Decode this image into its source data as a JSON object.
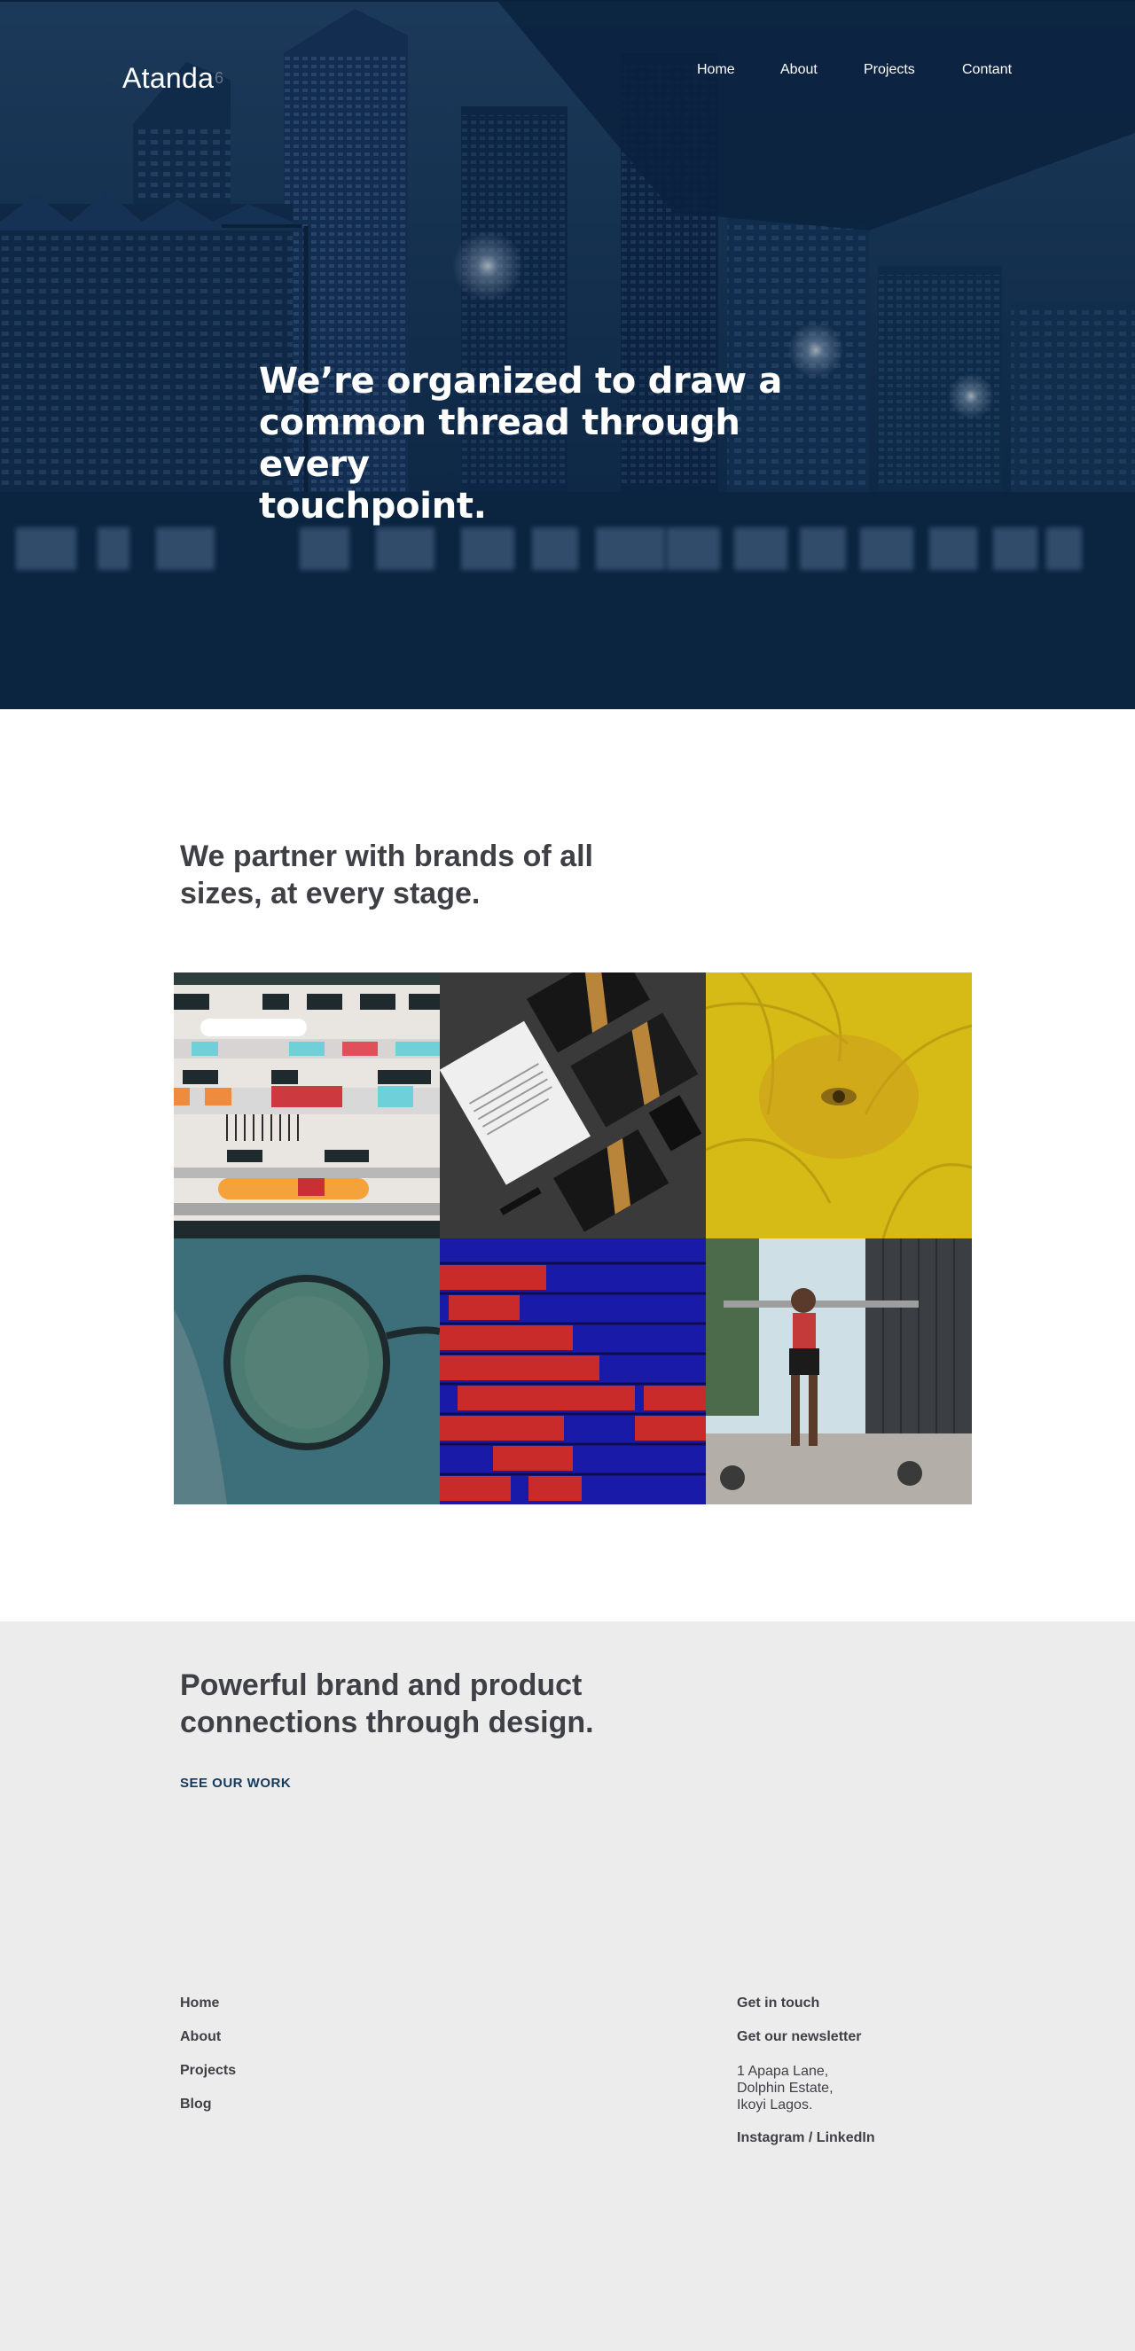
{
  "header": {
    "logo": "Atanda",
    "logo_mark": "6",
    "nav": [
      {
        "label": "Home"
      },
      {
        "label": "About"
      },
      {
        "label": "Projects"
      },
      {
        "label": "Contant"
      }
    ]
  },
  "hero": {
    "title_lines": [
      "We’re organized to draw a",
      "common thread through every",
      "touchpoint."
    ],
    "background": "night-city-street-photo",
    "overlay_color": "#0b2540"
  },
  "intro": {
    "lines": [
      "We partner with brands of all",
      "sizes, at every stage."
    ]
  },
  "gallery": [
    {
      "name": "colorful-apartment-building-image"
    },
    {
      "name": "black-gold-stationery-mockup-image"
    },
    {
      "name": "yellow-fern-eye-image"
    },
    {
      "name": "eyeglasses-in-hand-image"
    },
    {
      "name": "red-blue-brick-wall-image"
    },
    {
      "name": "weightlifter-outdoors-image"
    }
  ],
  "cta_section": {
    "lines": [
      "Powerful brand and product",
      "connections through design."
    ],
    "link": "SEE OUR WORK",
    "link_color": "#123a5e"
  },
  "footer": {
    "links": [
      "Home",
      "About",
      "Projects",
      "Blog"
    ],
    "contact": {
      "get_in_touch": "Get in touch",
      "newsletter": "Get our newsletter",
      "address": [
        "1 Apapa Lane,",
        "Dolphin Estate,",
        "Ikoyi Lagos."
      ],
      "social": "Instagram / LinkedIn"
    }
  },
  "colors": {
    "hero_bg": "#0b233d",
    "page_bg": "#ececec",
    "text": "#3f3f46"
  }
}
